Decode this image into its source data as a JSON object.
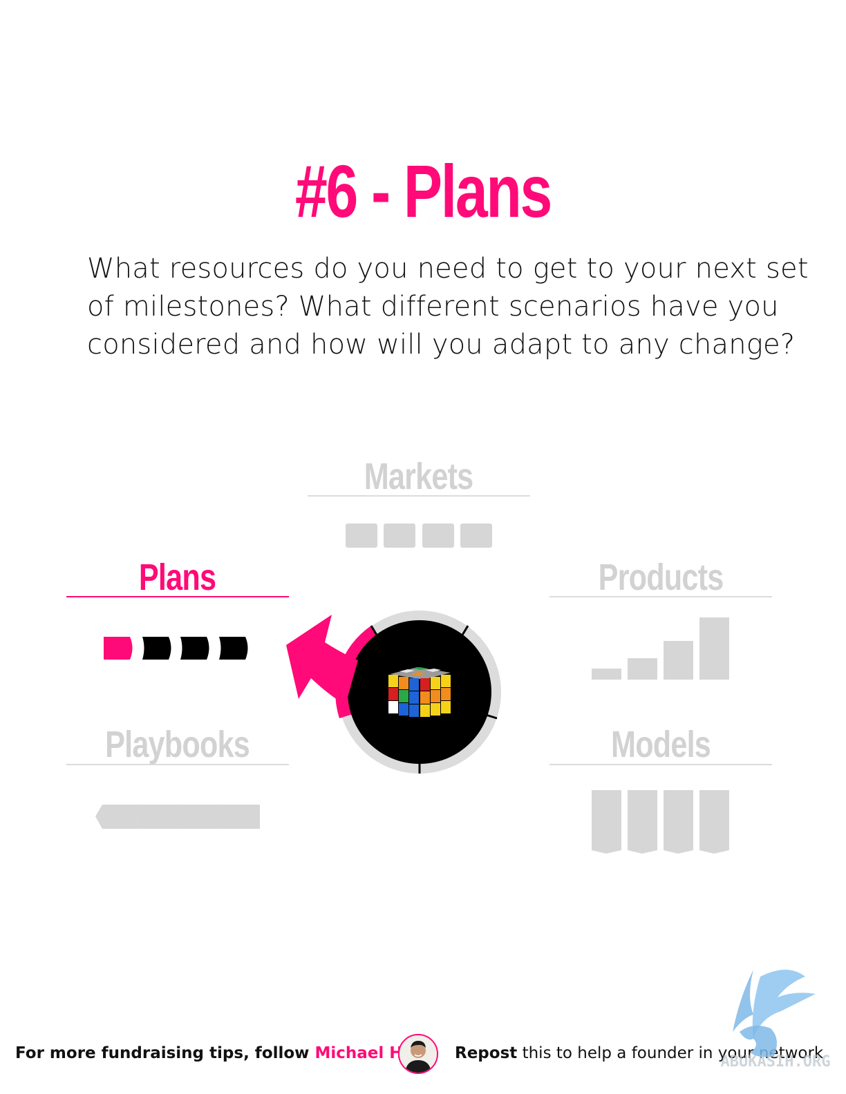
{
  "title": "#6 - Plans",
  "question": "What resources do you need to get to your next set of milestones? What different scenarios have you considered and how will you adapt to any change?",
  "categories": {
    "markets": "Markets",
    "plans": "Plans",
    "products": "Products",
    "playbooks": "Playbooks",
    "models": "Models"
  },
  "colors": {
    "accent": "#ff0a78",
    "inactive": "#d2d2d2",
    "ring": "#dcdcdc",
    "dark": "#000000"
  },
  "footer": {
    "follow_prefix": "For more fundraising tips, follow",
    "author": "Michael Ho",
    "repost_strong": "Repost",
    "repost_rest": "this to help a founder in your network"
  },
  "watermark": "ABUKASIH.ORG"
}
